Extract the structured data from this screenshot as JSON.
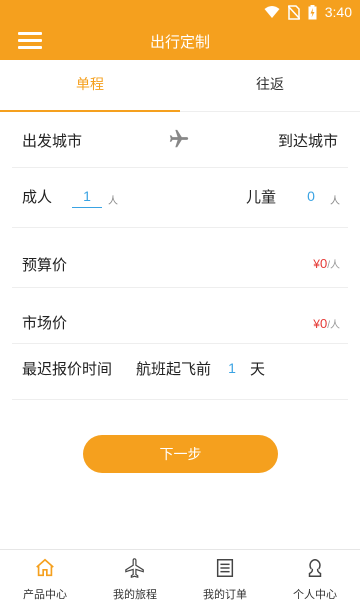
{
  "status_bar": {
    "time": "3:40",
    "icons": [
      "wifi-icon",
      "no-sim-icon",
      "battery-charging-icon"
    ]
  },
  "app_bar": {
    "title": "出行定制",
    "menu_icon": "menu-icon"
  },
  "tabs": [
    {
      "label": "单程",
      "active": true
    },
    {
      "label": "往返",
      "active": false
    }
  ],
  "route": {
    "from": "出发城市",
    "to": "到达城市",
    "icon": "plane-icon"
  },
  "passengers": {
    "adult_label": "成人",
    "adult_value": "1",
    "adult_unit": "人",
    "child_label": "儿童",
    "child_value": "0",
    "child_unit": "人"
  },
  "budget": {
    "label": "预算价",
    "currency": "¥",
    "amount": "0",
    "per": "/人"
  },
  "market": {
    "label": "市场价",
    "currency": "¥",
    "amount": "0",
    "per": "/人"
  },
  "quote_deadline": {
    "label": "最迟报价时间",
    "before_label": "航班起飞前",
    "days_value": "1",
    "days_unit": "天"
  },
  "next_button": {
    "label": "下一步"
  },
  "bottom_nav": [
    {
      "label": "产品中心",
      "icon": "home-icon",
      "active": true
    },
    {
      "label": "我的旅程",
      "icon": "plane-icon",
      "active": false
    },
    {
      "label": "我的订单",
      "icon": "order-list-icon",
      "active": false
    },
    {
      "label": "个人中心",
      "icon": "person-icon",
      "active": false
    }
  ],
  "colors": {
    "accent": "#f5a01e",
    "input_blue": "#3aa3e3",
    "price_red": "#e53935"
  }
}
